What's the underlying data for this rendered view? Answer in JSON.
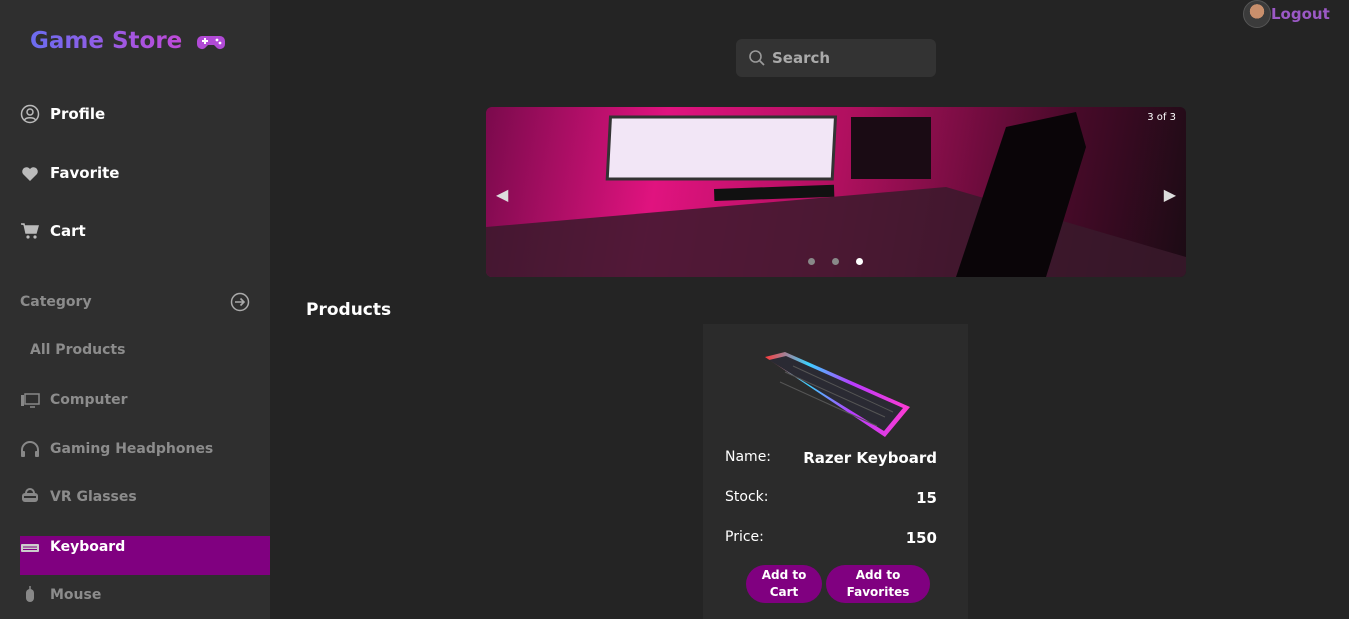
{
  "brand": {
    "title": "Game Store"
  },
  "nav": [
    {
      "label": "Profile",
      "icon": "user-circle-icon"
    },
    {
      "label": "Favorite",
      "icon": "heart-icon"
    },
    {
      "label": "Cart",
      "icon": "cart-icon"
    }
  ],
  "category": {
    "heading": "Category",
    "items": [
      {
        "label": "All Products"
      },
      {
        "label": "Computer",
        "icon": "monitor-icon"
      },
      {
        "label": "Gaming Headphones",
        "icon": "headphones-icon"
      },
      {
        "label": "VR Glasses",
        "icon": "vr-icon"
      },
      {
        "label": "Keyboard",
        "icon": "keyboard-icon",
        "active": true
      },
      {
        "label": "Mouse",
        "icon": "mouse-icon"
      }
    ]
  },
  "search": {
    "placeholder": "Search"
  },
  "header": {
    "logout_label": "Logout"
  },
  "carousel": {
    "counter": "3 of 3",
    "active_slide": 3,
    "slides": 3
  },
  "products": {
    "title": "Products",
    "items": [
      {
        "name_label": "Name:",
        "name": "Razer Keyboard",
        "stock_label": "Stock:",
        "stock": "15",
        "price_label": "Price:",
        "price": "150",
        "add_cart": "Add to Cart",
        "add_fav": "Add to Favorites"
      }
    ]
  },
  "colors": {
    "accent": "#800080",
    "background": "#242424",
    "sidebar": "#2f2f2f"
  }
}
